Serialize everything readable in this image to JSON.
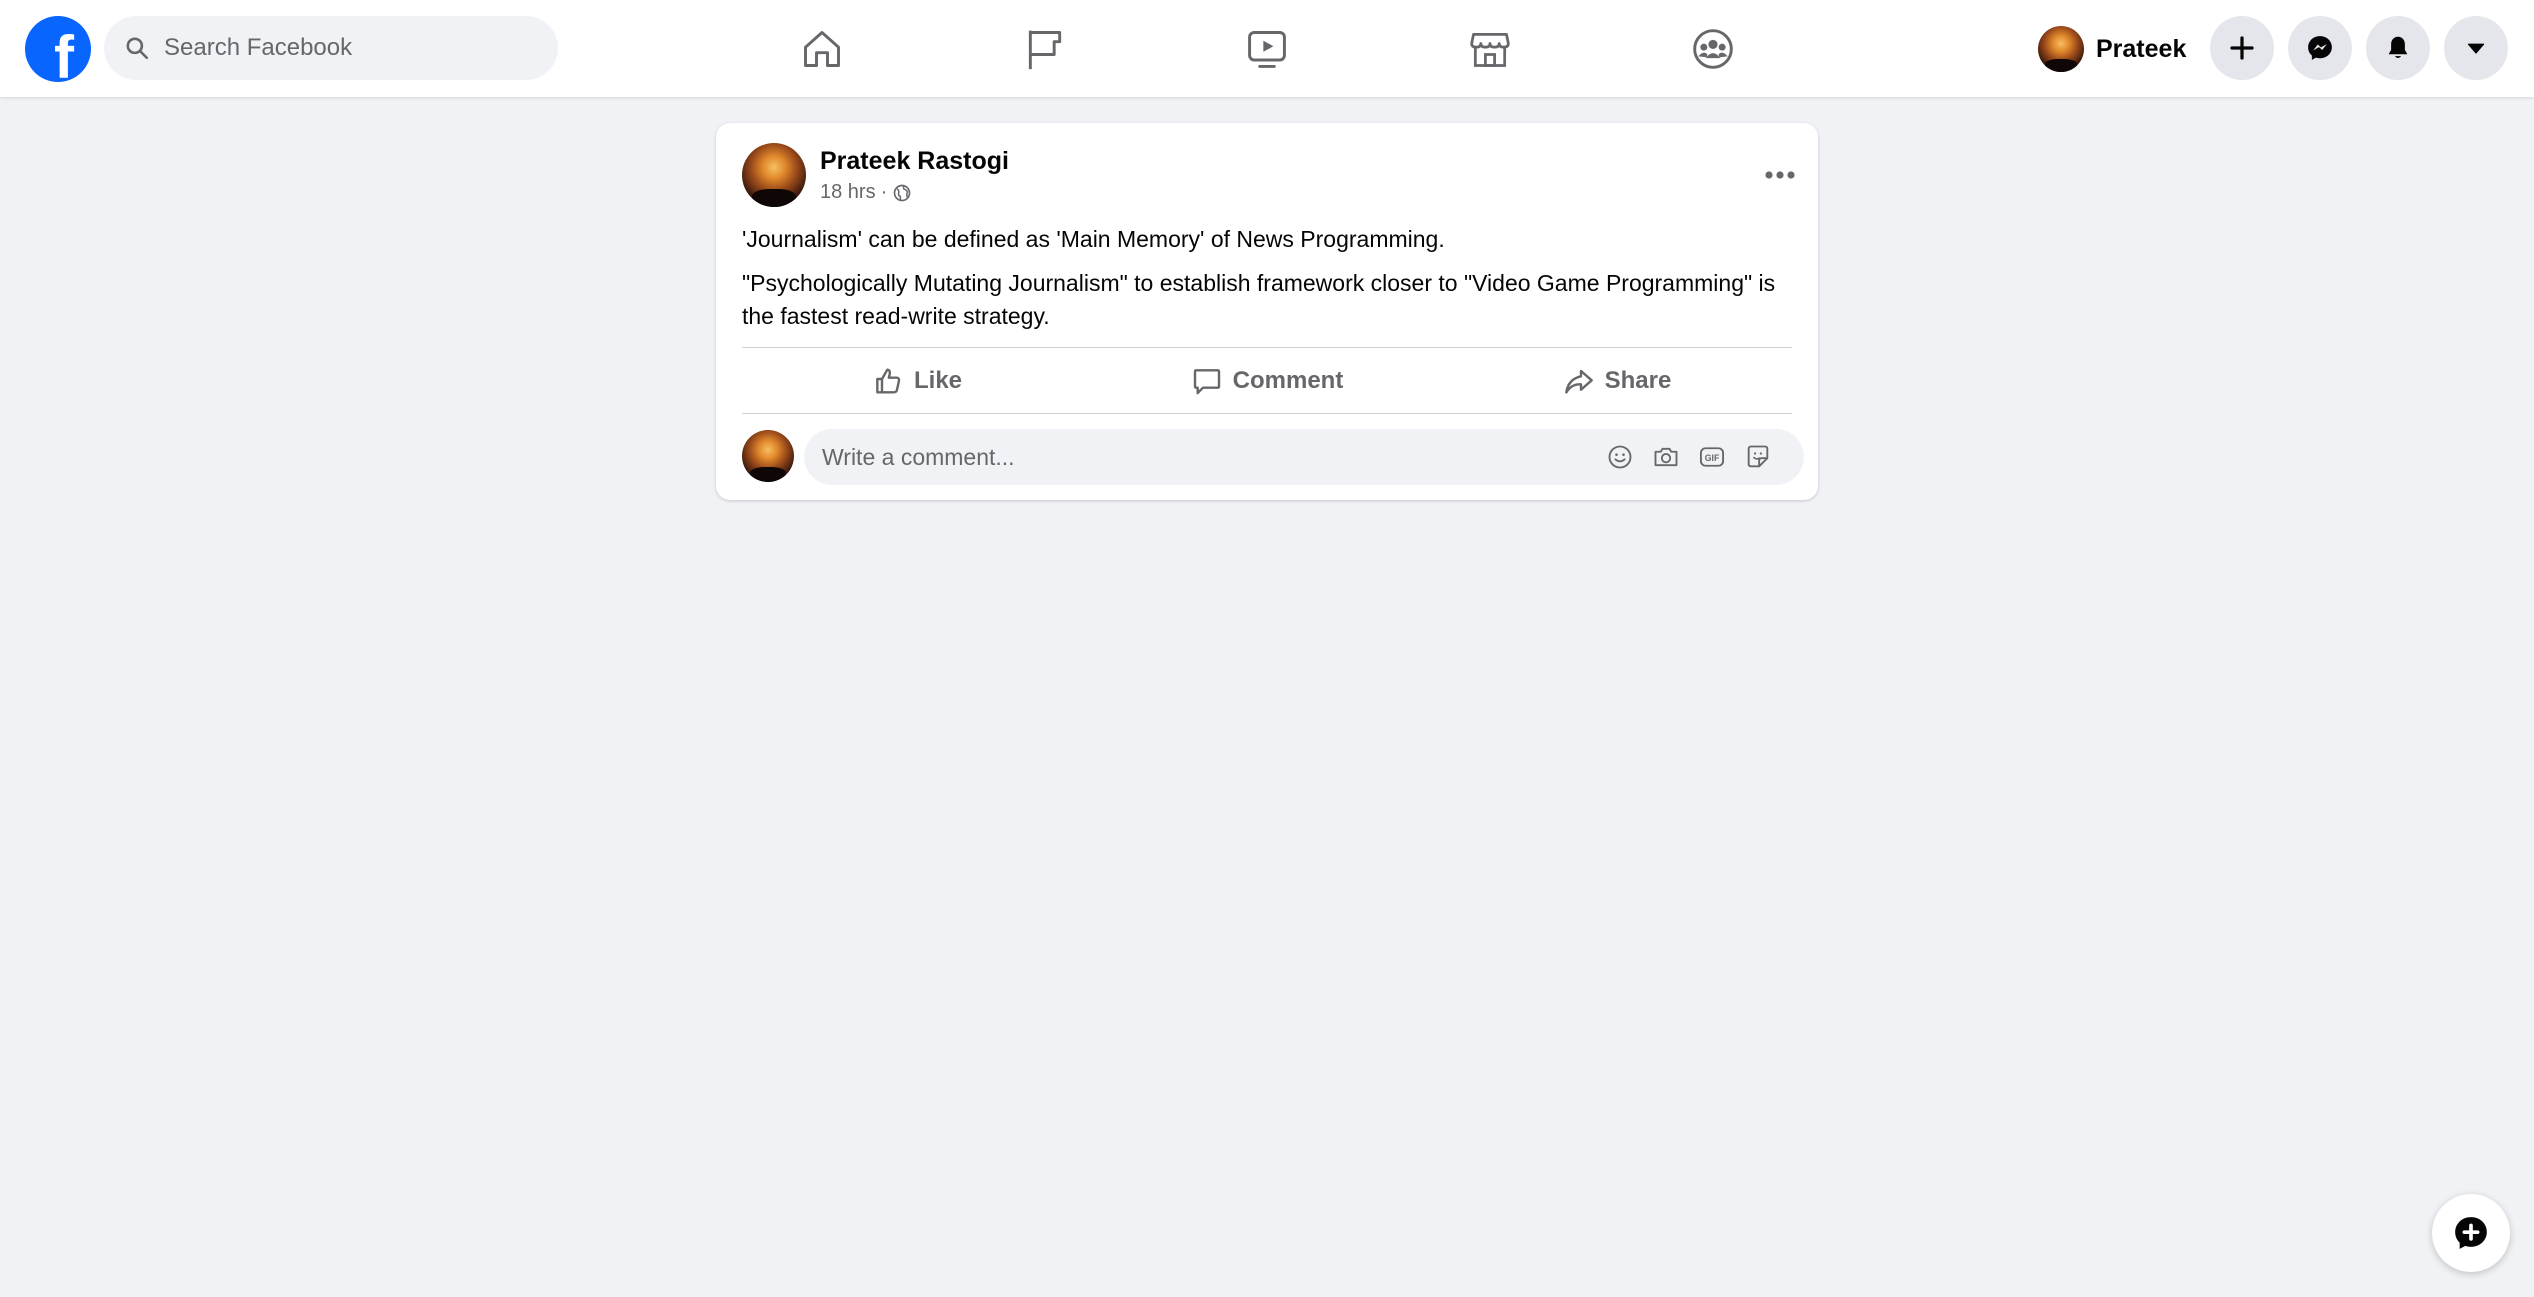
{
  "topbar": {
    "logo_icon": "facebook-logo",
    "search": {
      "placeholder": "Search Facebook",
      "value": ""
    },
    "nav_tabs": [
      {
        "name": "home",
        "icon": "home-icon"
      },
      {
        "name": "pages",
        "icon": "flag-icon"
      },
      {
        "name": "watch",
        "icon": "video-play-icon"
      },
      {
        "name": "marketplace",
        "icon": "store-icon"
      },
      {
        "name": "groups",
        "icon": "groups-icon"
      }
    ],
    "profile": {
      "name": "Prateek"
    },
    "actions": [
      {
        "name": "create",
        "icon": "plus-icon"
      },
      {
        "name": "messenger",
        "icon": "messenger-icon"
      },
      {
        "name": "notifications",
        "icon": "bell-icon"
      },
      {
        "name": "account",
        "icon": "caret-down-icon"
      }
    ]
  },
  "post": {
    "author": "Prateek Rastogi",
    "timestamp": "18 hrs",
    "separator": "·",
    "privacy_icon": "globe-icon",
    "paragraphs": [
      "'Journalism' can be defined as 'Main Memory' of News Programming.",
      "\"Psychologically Mutating Journalism\" to establish framework closer to \"Video Game Programming\" is the fastest read-write strategy."
    ],
    "actions": {
      "like": "Like",
      "comment": "Comment",
      "share": "Share"
    },
    "comment_box": {
      "placeholder": "Write a comment...",
      "value": "",
      "icons": [
        "emoji-icon",
        "camera-icon",
        "gif-icon",
        "sticker-icon"
      ]
    }
  },
  "floating": {
    "icon": "new-message-icon"
  },
  "colors": {
    "brand": "#0866ff",
    "background": "#f0f2f5",
    "surface": "#ffffff",
    "secondary_text": "#65676b",
    "primary_text": "#050505",
    "button_bg": "#e4e6eb"
  }
}
